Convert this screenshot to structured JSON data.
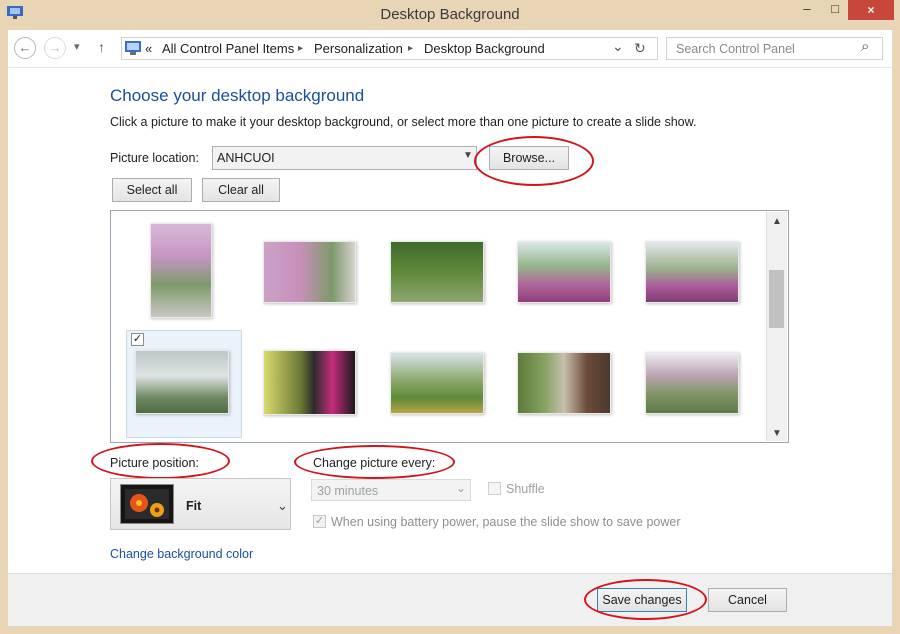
{
  "window": {
    "title": "Desktop Background",
    "minimize": "–",
    "maximize": "□",
    "close": "×"
  },
  "nav": {
    "back": "←",
    "forward": "→",
    "recent": "▾",
    "up": "↑",
    "overflow": "«",
    "breadcrumb": [
      "All Control Panel Items",
      "Personalization",
      "Desktop Background"
    ],
    "separator": "▸",
    "dropdown": "⌄",
    "refresh": "↻",
    "search_placeholder": "Search Control Panel",
    "search_glyph": "⌕"
  },
  "page": {
    "heading": "Choose your desktop background",
    "instruction": "Click a picture to make it your desktop background, or select more than one picture to create a slide show.",
    "picture_location_label": "Picture location:",
    "picture_location_value": "ANHCUOI",
    "browse": "Browse...",
    "select_all": "Select all",
    "clear_all": "Clear all",
    "checkmark": "✓",
    "picture_position_label": "Picture position:",
    "picture_position_value": "Fit",
    "change_picture_label": "Change picture every:",
    "interval_value": "30 minutes",
    "shuffle": "Shuffle",
    "battery_option": "When using battery power, pause the slide show to save power",
    "change_color_link": "Change background color",
    "save": "Save changes",
    "cancel": "Cancel"
  },
  "colors": {
    "accent": "#1b4f9c",
    "annotation": "#d3141d",
    "frame": "#e7d5b6",
    "close": "#c7473a"
  }
}
